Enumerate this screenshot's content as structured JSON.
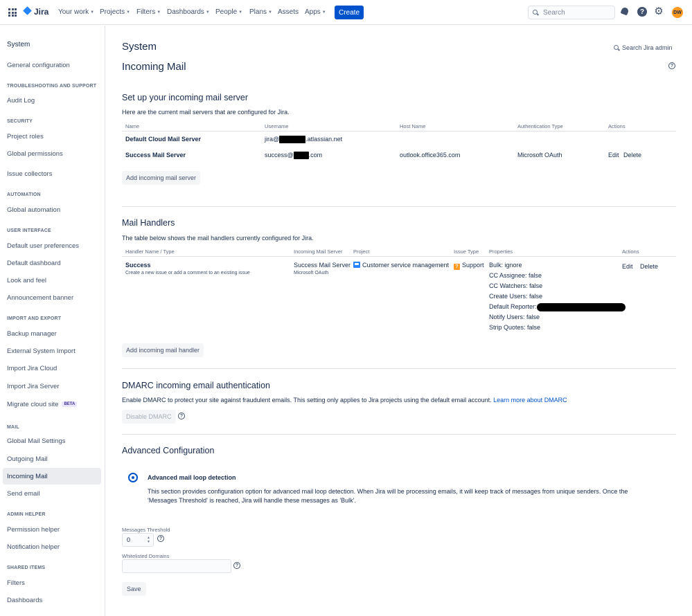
{
  "topnav": {
    "logo": "Jira",
    "items": [
      "Your work",
      "Projects",
      "Filters",
      "Dashboards",
      "People",
      "Plans",
      "Assets",
      "Apps"
    ],
    "create": "Create",
    "search_placeholder": "Search",
    "avatar_initials": "DW"
  },
  "sidebar": {
    "title": "System",
    "general": "General configuration",
    "sections": {
      "troubleshooting": "TROUBLESHOOTING AND SUPPORT",
      "security": "SECURITY",
      "automation": "AUTOMATION",
      "ui": "USER INTERFACE",
      "import_export": "IMPORT AND EXPORT",
      "mail": "MAIL",
      "admin_helper": "ADMIN HELPER",
      "shared": "SHARED ITEMS"
    },
    "items": {
      "audit_log": "Audit Log",
      "project_roles": "Project roles",
      "global_permissions": "Global permissions",
      "issue_collectors": "Issue collectors",
      "global_automation": "Global automation",
      "default_user_prefs": "Default user preferences",
      "default_dashboard": "Default dashboard",
      "look_and_feel": "Look and feel",
      "announcement_banner": "Announcement banner",
      "backup_manager": "Backup manager",
      "external_import": "External System Import",
      "import_cloud": "Import Jira Cloud",
      "import_server": "Import Jira Server",
      "migrate_cloud": "Migrate cloud site",
      "beta": "BETA",
      "global_mail": "Global Mail Settings",
      "outgoing_mail": "Outgoing Mail",
      "incoming_mail": "Incoming Mail",
      "send_email": "Send email",
      "permission_helper": "Permission helper",
      "notification_helper": "Notification helper",
      "filters": "Filters",
      "dashboards": "Dashboards"
    }
  },
  "main": {
    "system_title": "System",
    "page_title": "Incoming Mail",
    "search_admin": "Search Jira admin",
    "mail_servers": {
      "title": "Set up your incoming mail server",
      "description": "Here are the current mail servers that are configured for Jira.",
      "headers": [
        "Name",
        "Username",
        "Host Name",
        "Authentication Type",
        "Actions"
      ],
      "rows": [
        {
          "name": "Default Cloud Mail Server",
          "user_prefix": "jira@",
          "user_suffix": ".atlassian.net",
          "host": "",
          "auth": ""
        },
        {
          "name": "Success Mail Server",
          "user_prefix": "success@",
          "user_suffix": ".com",
          "host": "outlook.office365.com",
          "auth": "Microsoft OAuth",
          "edit": "Edit",
          "delete": "Delete"
        }
      ],
      "add_button": "Add incoming mail server"
    },
    "handlers": {
      "title": "Mail Handlers",
      "description": "The table below shows the mail handlers currently configured for Jira.",
      "headers": [
        "Handler Name / Type",
        "Incoming Mail Server",
        "Project",
        "Issue Type",
        "Properties",
        "Actions"
      ],
      "row": {
        "name": "Success",
        "type": "Create a new issue or add a comment to an existing issue",
        "server": "Success Mail Server",
        "server_sub": "Microsoft OAuth",
        "project": "Customer service management",
        "issue_type": "Support",
        "properties": [
          "Bulk: ignore",
          "CC Assignee: false",
          "CC Watchers: false",
          "Create Users: false",
          "Default Reporter:",
          "Notify Users: false",
          "Strip Quotes: false"
        ],
        "edit": "Edit",
        "delete": "Delete"
      },
      "add_button": "Add incoming mail handler"
    },
    "dmarc": {
      "title": "DMARC incoming email authentication",
      "description": "Enable DMARC to protect your site against fraudulent emails. This setting only applies to Jira projects using the default email account.",
      "learn_more": "Learn more about DMARC",
      "button": "Disable DMARC"
    },
    "advanced": {
      "title": "Advanced Configuration",
      "loop_title": "Advanced mail loop detection",
      "loop_desc_1": "This section provides configuration option for advanced mail loop detection. When Jira will be processing emails, it will keep track of messages from unique senders. Once the",
      "loop_desc_2": "'Messages Threshold' is reached, Jira will handle these messages as 'Bulk'.",
      "threshold_label": "Messages Threshold",
      "threshold_value": "0",
      "domains_label": "Whitelisted Domains",
      "domains_value": "",
      "save": "Save"
    }
  }
}
